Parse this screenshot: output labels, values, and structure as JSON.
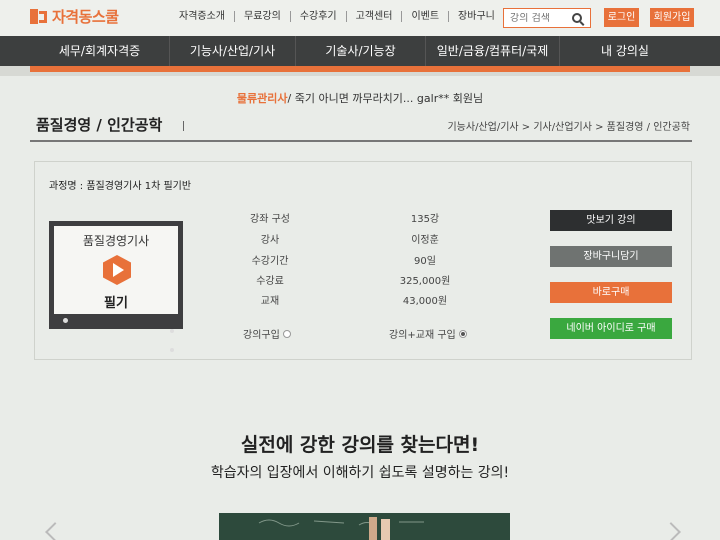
{
  "header": {
    "logo_text": "자격동스쿨",
    "util_links": [
      "자격증소개",
      "무료강의",
      "수강후기",
      "고객센터",
      "이벤트",
      "장바구니"
    ],
    "search_placeholder": "강의 검색",
    "login_label": "로그인",
    "join_label": "회원가입"
  },
  "nav": {
    "items": [
      "세무/회계자격증",
      "기능사/산업/기사",
      "기술사/기능장",
      "일반/금융/컴퓨터/국제",
      "내 강의실"
    ]
  },
  "ticker": {
    "category": "물류관리사",
    "message": "/ 죽기 아니면 까무라치기... galr** 회원님"
  },
  "page": {
    "title": "품질경영 / 인간공학",
    "breadcrumb": "기능사/산업/기사 > 기사/산업기사 > 품질경영 / 인간공학"
  },
  "course": {
    "name_label": "과정명 :",
    "name_value": "품질경영기사 1차 필기반",
    "thumb_title": "품질경영기사",
    "thumb_label": "필기",
    "info": [
      {
        "label": "강좌 구성",
        "value": "135강"
      },
      {
        "label": "강사",
        "value": "이정훈"
      },
      {
        "label": "수강기간",
        "value": "90일"
      },
      {
        "label": "수강료",
        "value": "325,000원"
      },
      {
        "label": "교재",
        "value": "43,000원"
      }
    ],
    "options": [
      {
        "label": "강의구입",
        "selected": false
      },
      {
        "label": "강의+교재 구입",
        "selected": true
      }
    ],
    "actions": [
      {
        "label": "맛보기 강의",
        "color": "#2d2f30"
      },
      {
        "label": "장바구니담기",
        "color": "#6f7371"
      },
      {
        "label": "바로구매",
        "color": "#e8713a"
      },
      {
        "label": "네이버 아이디로 구매",
        "color": "#3aa83f"
      }
    ]
  },
  "promo": {
    "headline": "실전에 강한 강의를 찾는다면!",
    "subline": "학습자의 입장에서 이해하기 쉽도록 설명하는 강의!"
  }
}
